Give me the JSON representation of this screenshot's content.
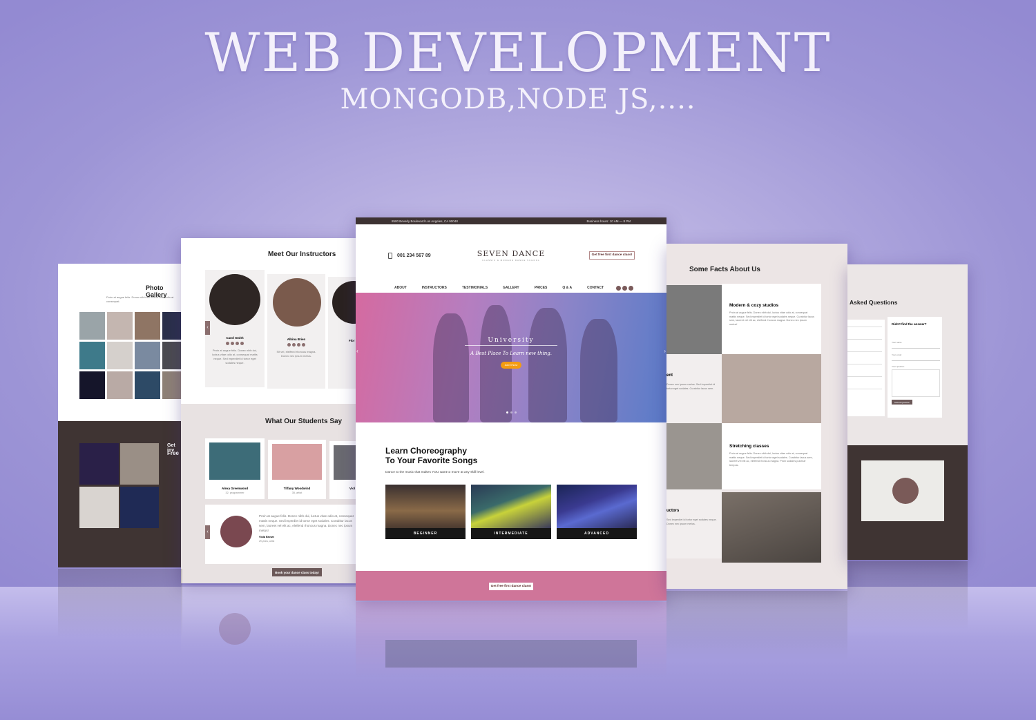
{
  "hero": {
    "title": "WEB DEVELOPMENT",
    "subtitle": "MONGODB,NODE JS,...."
  },
  "center": {
    "topbar": {
      "address": "8500 Beverly Boulevard Los Angeles, CA 90048",
      "hours": "Business hours: 10 AM — 8 PM"
    },
    "phone": "001 234 567 89",
    "logo": "SEVEN DANCE",
    "logo_tagline": "CLASSIC & MODERN DANCE SCHOOL",
    "cta_top": "Get free first dance class!",
    "nav": [
      "ABOUT",
      "INSTRUCTORS",
      "TESTIMONIALS",
      "GALLERY",
      "PRICES",
      "Q & A",
      "CONTACT"
    ],
    "slider": {
      "title": "University",
      "tagline": "A Best Place To Learn new thing.",
      "button": "Add It Now"
    },
    "section_title_1": "Learn Choreography",
    "section_title_2": "To Your Favorite Songs",
    "section_text": "Dance to the music that makes YOU want to move at any skill level.",
    "levels": [
      "BEGINNER",
      "INTERMEDIATE",
      "ADVANCED"
    ],
    "cta_bottom": "Get free first dance class!"
  },
  "left": {
    "instructors_title": "Meet Our Instructors",
    "instructors": [
      "Carol Smith",
      "Albina Brien",
      "Flor"
    ],
    "students_title": "What Our Students Say",
    "students": [
      {
        "name": "Alexa Greenwood",
        "sub": "32, programmer"
      },
      {
        "name": "Tiffany Woodwind",
        "sub": "35, artist"
      },
      {
        "name": "Viol",
        "sub": ""
      }
    ],
    "testimonial_name": "Viola Brown",
    "testimonial_sub": "29 years, artist",
    "testimonial_text": "Proin at augue felis. Donec nibh dui, luctus vitae odio at, consequat mattis neque. Sed imperdiet id tortor eget sodales. Curabitur lacus sem, laoreet vel elit ac, eleifend rhoncus magna. Donec nec ipsum metus!",
    "book_button": "Book your dance class today!",
    "gallery_title": "Photo Gallery",
    "invite_line1": "Get inv",
    "invite_line2": "Free"
  },
  "right": {
    "facts_title": "Some Facts About Us",
    "facts": [
      {
        "title": "Modern & cozy studios",
        "text": "Proin at augue felis. Donec nibh dui, luctus vitae odio at, consequat mattis neque. Sed imperdiet id tortor eget sodales neque. Curabitur lacus sem, laoreet vel elit ac, eleifend rhoncus magna. Donec nec ipsum metus!"
      },
      {
        "title": "Stretching classes",
        "text": "Proin at augue felis. Donec nibh dui, luctus vitae odio at, consequat mattis neque. Sed imperdiet id tortor eget sodales. Curabitur lacus sem, laoreet vel elit ac, eleifend rhoncus magna. Proin sodales pulvinar tempus."
      }
    ],
    "side_words": [
      "ent",
      "uctors"
    ],
    "faq_title": "Asked Questions",
    "faq_prompt": "Didn't find the answer?",
    "faq_fields": [
      "Your name",
      "Your email",
      "Your question"
    ],
    "faq_submit": "Submit Question"
  },
  "colors": {
    "accent": "#cf7599",
    "dark": "#3d3232",
    "orange": "#f39c12"
  }
}
